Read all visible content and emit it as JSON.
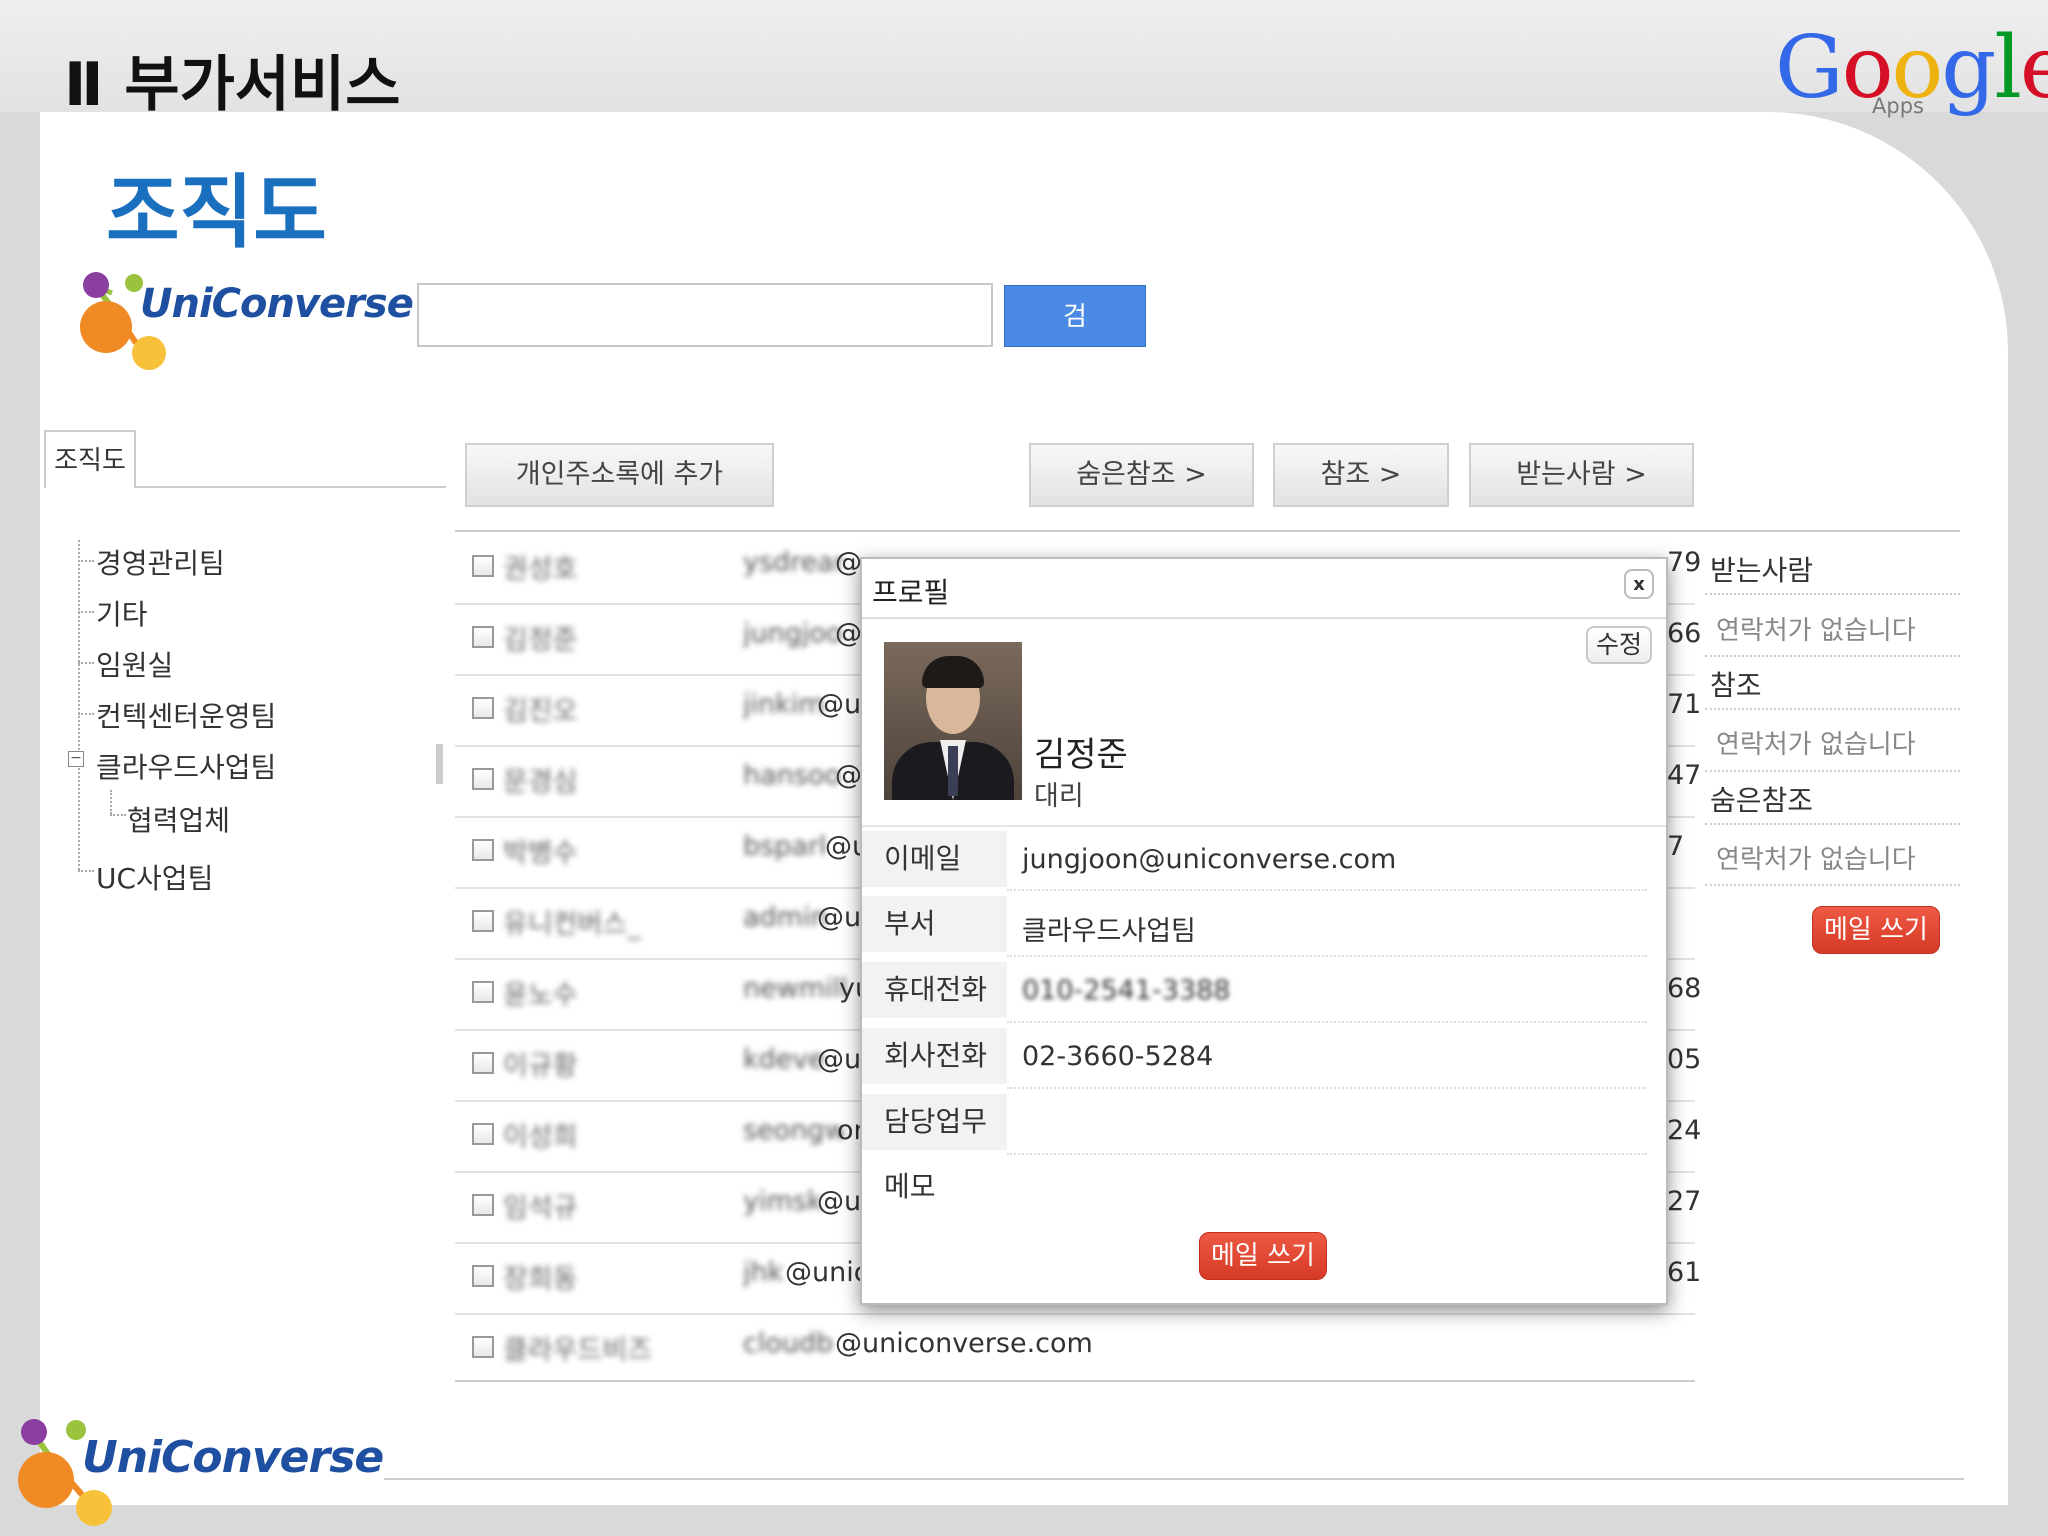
{
  "header": {
    "section_title": "Ⅱ 부가서비스",
    "page_title": "조직도",
    "google_logo_text": "Google",
    "google_apps_label": "Apps",
    "brand_colors": {
      "blue": "#1b6fbf",
      "google_blue": "#3369e8",
      "google_red": "#d50f25",
      "google_yellow": "#eeb211",
      "google_green": "#009925"
    }
  },
  "logo": {
    "text": "UniConverse"
  },
  "search": {
    "placeholder": "",
    "button_label": "검"
  },
  "sidebar": {
    "tab_label": "조직도",
    "tree": [
      "경영관리팀",
      "기타",
      "임원실",
      "컨텍센터운영팀",
      "클라우드사업팀",
      "협력업체",
      "UC사업팀"
    ],
    "collapse_symbol": "−"
  },
  "toolbar": {
    "add_contacts_label": "개인주소록에 추가",
    "bcc_label": "숨은참조 >",
    "cc_label": "참조 >",
    "to_label": "받는사람 >"
  },
  "contacts": [
    {
      "name": "권성호",
      "email_blur": "ysdream",
      "email_visible": "@",
      "trail": "79"
    },
    {
      "name": "김정준",
      "email_blur": "jungjoon",
      "email_visible": "@",
      "trail": "66"
    },
    {
      "name": "김진오",
      "email_blur": "jinkim",
      "email_visible": "@un",
      "trail": "71"
    },
    {
      "name": "문경심",
      "email_blur": "hansoon",
      "email_visible": "@",
      "trail": "47"
    },
    {
      "name": "박병수",
      "email_blur": "bspark",
      "email_visible": "@u",
      "trail": "7"
    },
    {
      "name": "유니컨버스_",
      "email_blur": "admin",
      "email_visible": "@un",
      "trail": ""
    },
    {
      "name": "윤노수",
      "email_blur": "newmille",
      "email_visible": "yu",
      "trail": "68"
    },
    {
      "name": "이규황",
      "email_blur": "kdever",
      "email_visible": "@uni",
      "trail": "05"
    },
    {
      "name": "이성희",
      "email_blur": "seongwon",
      "email_visible": "oni",
      "trail": "24"
    },
    {
      "name": "임석규",
      "email_blur": "yimsk",
      "email_visible": "@un",
      "trail": "27"
    },
    {
      "name": "장희동",
      "email_blur": "jhk",
      "email_visible": "@unico",
      "trail": "61"
    },
    {
      "name": "클라우드비즈",
      "email_blur": "cloudbiz",
      "email_visible": "@uniconverse.com",
      "trail": ""
    }
  ],
  "recipients": {
    "to_label": "받는사람",
    "cc_label": "참조",
    "bcc_label": "숨은참조",
    "empty_text": "연락처가 없습니다",
    "compose_label": "메일 쓰기"
  },
  "profile_popup": {
    "title": "프로필",
    "close_label": "x",
    "edit_label": "수정",
    "name": "김정준",
    "rank": "대리",
    "fields": [
      {
        "label": "이메일",
        "value": "jungjoon@uniconverse.com"
      },
      {
        "label": "부서",
        "value": "클라우드사업팀"
      },
      {
        "label": "휴대전화",
        "value": "010-2541-3388"
      },
      {
        "label": "회사전화",
        "value": "02-3660-5284"
      },
      {
        "label": "담당업무",
        "value": ""
      },
      {
        "label": "메모",
        "value": ""
      }
    ],
    "compose_label": "메일 쓰기"
  }
}
